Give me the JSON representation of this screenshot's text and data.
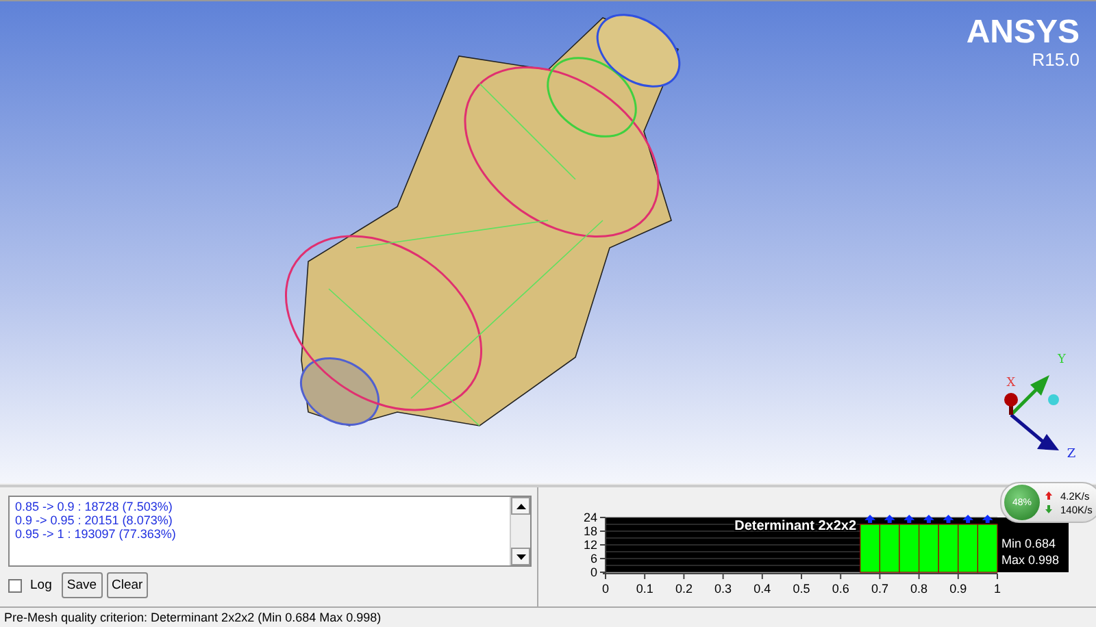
{
  "viewport": {
    "logo": "ANSYS",
    "version": "R15.0",
    "axes": [
      "X",
      "Y",
      "Z"
    ]
  },
  "log": {
    "lines": [
      "0.85 -> 0.9 : 18728 (7.503%)",
      "0.9 -> 0.95 : 20151 (8.073%)",
      "0.95 -> 1 : 193097 (77.363%)"
    ],
    "log_checkbox": {
      "label": "Log",
      "checked": false
    },
    "buttons": [
      "Save",
      "Clear"
    ]
  },
  "histogram": {
    "chart_data": {
      "type": "bar",
      "title": "Determinant 2x2x2",
      "x": [
        0.675,
        0.725,
        0.775,
        0.825,
        0.875,
        0.925,
        0.975
      ],
      "values": [
        21,
        21,
        21,
        21,
        21,
        21,
        21
      ],
      "grid": true,
      "xlim": [
        0,
        1
      ],
      "ylim": [
        0,
        24
      ],
      "xticks": [
        0,
        0.1,
        0.2,
        0.3,
        0.4,
        0.5,
        0.6,
        0.7,
        0.8,
        0.9,
        1
      ],
      "yticks": [
        0,
        6,
        12,
        18,
        24
      ],
      "annotations": [
        "Min 0.684",
        "Max 0.998"
      ]
    }
  },
  "network_widget": {
    "percent": "48%",
    "upload": "4.2K/s",
    "download": "140K/s"
  },
  "status_bar": "Pre-Mesh quality criterion: Determinant 2x2x2 (Min 0.684 Max 0.998)"
}
